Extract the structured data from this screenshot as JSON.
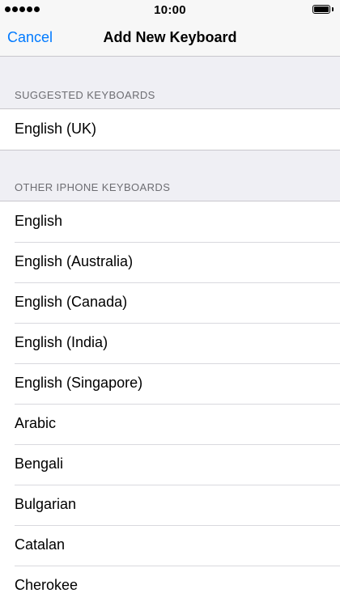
{
  "status_bar": {
    "time": "10:00",
    "signal_icon": "signal-dots-icon",
    "battery_icon": "battery-icon",
    "battery_level_percent": 100
  },
  "nav": {
    "cancel_label": "Cancel",
    "title": "Add New Keyboard"
  },
  "sections": {
    "suggested": {
      "header": "SUGGESTED KEYBOARDS",
      "items": [
        "English (UK)"
      ]
    },
    "other": {
      "header": "OTHER IPHONE KEYBOARDS",
      "items": [
        "English",
        "English (Australia)",
        "English (Canada)",
        "English (India)",
        "English (Singapore)",
        "Arabic",
        "Bengali",
        "Bulgarian",
        "Catalan",
        "Cherokee"
      ]
    }
  },
  "colors": {
    "accent": "#007aff",
    "background": "#efeff4",
    "header_text": "#6d6d72"
  }
}
